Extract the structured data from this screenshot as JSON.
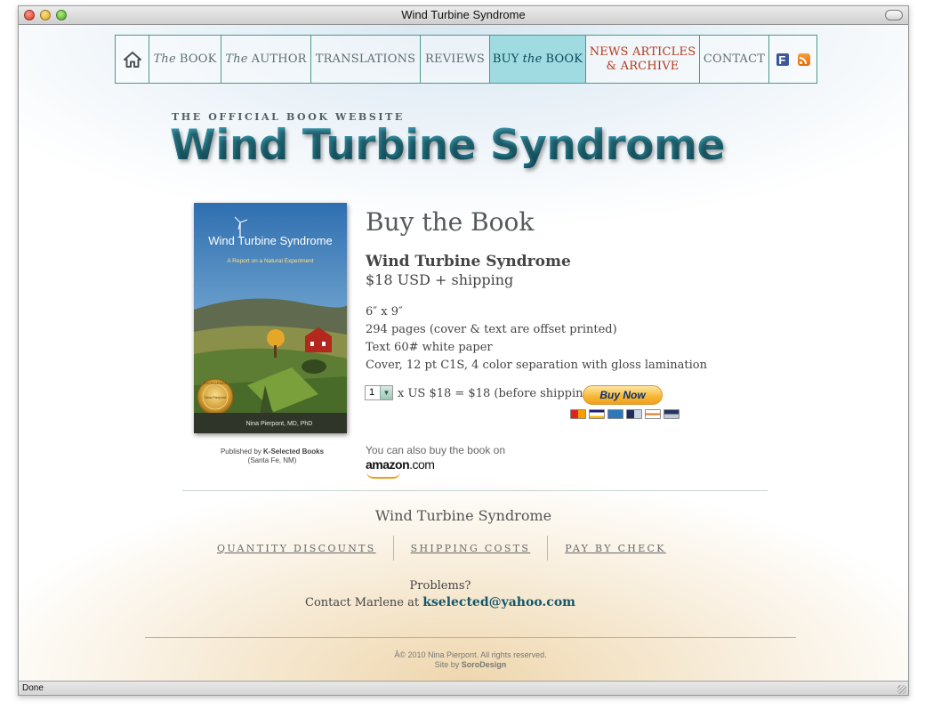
{
  "window": {
    "title": "Wind Turbine Syndrome"
  },
  "status_bar": {
    "text": "Done"
  },
  "nav": {
    "home_icon": "home-icon",
    "items": [
      {
        "em": "The",
        "label": "BOOK"
      },
      {
        "em": "The",
        "label": "AUTHOR"
      },
      {
        "label": "TRANSLATIONS"
      },
      {
        "label": "REVIEWS"
      },
      {
        "pre": "BUY",
        "em": "the",
        "label": "BOOK"
      },
      {
        "line1": "NEWS ARTICLES",
        "line2": "& ARCHIVE"
      },
      {
        "label": "CONTACT"
      }
    ],
    "social_icons": [
      "facebook-icon",
      "rss-icon"
    ],
    "facebook_glyph": "f",
    "colors": {
      "active_bg": "#9fdbe0",
      "news_text": "#b2391c",
      "border": "#4a9a8a"
    }
  },
  "header": {
    "tagline": "THE OFFICIAL BOOK WEBSITE",
    "title": "Wind Turbine Syndrome",
    "title_color": "#1e7a8c"
  },
  "book": {
    "cover_title": "Wind Turbine Syndrome",
    "cover_subtitle": "A Report on a Natural Experiment",
    "cover_author": "Nina Pierpont, MD, PhD",
    "seal_text": "EXCELLENCE",
    "seal_center": "Nina Pierpont",
    "publisher_prefix": "Published by",
    "publisher_name": "K-Selected Books",
    "publisher_location": "(Santa Fe, NM)"
  },
  "product": {
    "heading": "Buy the Book",
    "name": "Wind Turbine Syndrome",
    "price": "$18 USD + shipping",
    "specs": [
      "6″ x 9″",
      "294 pages (cover & text are offset printed)",
      "Text 60# white paper",
      "Cover, 12 pt C1S, 4 color separation with gloss lamination"
    ],
    "quantity": "1",
    "price_calc": "x US $18 = $18 (before shipping)",
    "buy_button": "Buy Now",
    "payment_icons": [
      "mastercard-icon",
      "visa-icon",
      "amex-icon",
      "discover-icon",
      "echeck-icon",
      "bank-icon"
    ],
    "amazon_note": "You can also buy the book on",
    "amazon_logo": "amazon",
    "amazon_suffix": ".com"
  },
  "footer": {
    "title": "Wind Turbine Syndrome",
    "links": [
      "QUANTITY DISCOUNTS",
      "SHIPPING COSTS",
      "PAY BY CHECK"
    ],
    "problems": "Problems?",
    "contact_prefix": "Contact Marlene at",
    "contact_email": "kselected@yahoo.com",
    "copyright": "Â© 2010 Nina Pierpont. All rights reserved.",
    "credit_prefix": "Site by",
    "credit_name": "SoroDesign"
  }
}
